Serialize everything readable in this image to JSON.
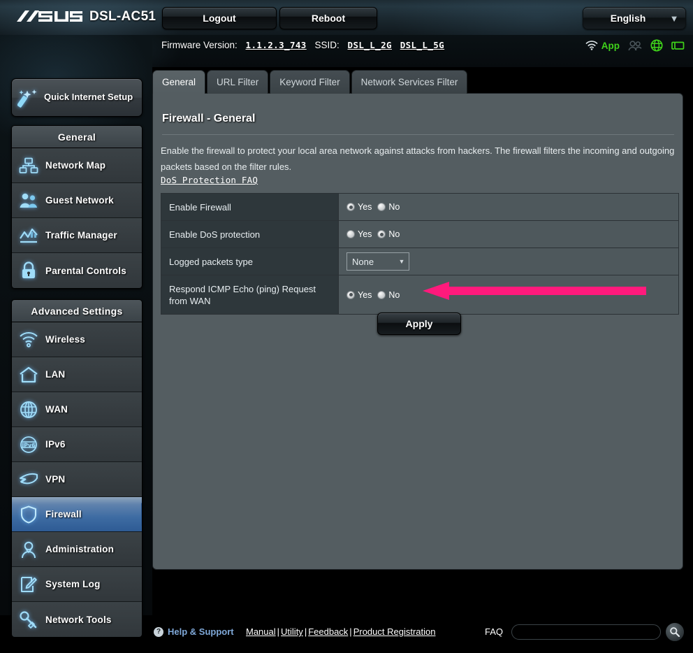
{
  "header": {
    "brand": "ASUS",
    "model": "DSL-AC51",
    "logout_label": "Logout",
    "reboot_label": "Reboot",
    "language": "English",
    "firmware_label": "Firmware Version:",
    "firmware_version": "1.1.2.3_743",
    "ssid_label": "SSID:",
    "ssid_2g": "DSL_L_2G",
    "ssid_5g": "DSL_L_5G",
    "app_label": "App",
    "icons": [
      "wifi-icon",
      "app-icon",
      "guests-icon",
      "globe-icon",
      "monitor-icon"
    ]
  },
  "sidebar": {
    "quick_setup": "Quick Internet Setup",
    "groups": [
      {
        "title": "General",
        "items": [
          {
            "label": "Network Map",
            "icon": "network-map-icon",
            "active": false
          },
          {
            "label": "Guest Network",
            "icon": "guest-network-icon",
            "active": false
          },
          {
            "label": "Traffic Manager",
            "icon": "traffic-manager-icon",
            "active": false
          },
          {
            "label": "Parental Controls",
            "icon": "parental-controls-icon",
            "active": false
          }
        ]
      },
      {
        "title": "Advanced Settings",
        "items": [
          {
            "label": "Wireless",
            "icon": "wireless-icon",
            "active": false
          },
          {
            "label": "LAN",
            "icon": "lan-icon",
            "active": false
          },
          {
            "label": "WAN",
            "icon": "wan-icon",
            "active": false
          },
          {
            "label": "IPv6",
            "icon": "ipv6-icon",
            "active": false
          },
          {
            "label": "VPN",
            "icon": "vpn-icon",
            "active": false
          },
          {
            "label": "Firewall",
            "icon": "firewall-icon",
            "active": true
          },
          {
            "label": "Administration",
            "icon": "administration-icon",
            "active": false
          },
          {
            "label": "System Log",
            "icon": "system-log-icon",
            "active": false
          },
          {
            "label": "Network Tools",
            "icon": "network-tools-icon",
            "active": false
          }
        ]
      }
    ]
  },
  "tabs": [
    {
      "label": "General",
      "active": true
    },
    {
      "label": "URL Filter",
      "active": false
    },
    {
      "label": "Keyword Filter",
      "active": false
    },
    {
      "label": "Network Services Filter",
      "active": false
    }
  ],
  "panel": {
    "title": "Firewall - General",
    "description": "Enable the firewall to protect your local area network against attacks from hackers. The firewall filters the incoming and outgoing packets based on the filter rules.",
    "faq_link": "DoS Protection FAQ",
    "apply_label": "Apply",
    "rows": [
      {
        "label": "Enable Firewall",
        "type": "radio",
        "yes_label": "Yes",
        "no_label": "No",
        "value": "Yes"
      },
      {
        "label": "Enable DoS protection",
        "type": "radio",
        "yes_label": "Yes",
        "no_label": "No",
        "value": "No"
      },
      {
        "label": "Logged packets type",
        "type": "select",
        "value": "None"
      },
      {
        "label": "Respond ICMP Echo (ping) Request from WAN",
        "type": "radio",
        "yes_label": "Yes",
        "no_label": "No",
        "value": "Yes"
      }
    ]
  },
  "annotation": {
    "type": "arrow",
    "color": "#ff1a7c",
    "points_to": "respond-icmp-row"
  },
  "footer": {
    "help_support": "Help & Support",
    "links": [
      "Manual",
      "Utility",
      "Feedback",
      "Product Registration"
    ],
    "separator": "|",
    "faq_label": "FAQ",
    "faq_placeholder": "",
    "faq_value": ""
  },
  "colors": {
    "accent_blue": "#2e5b94",
    "panel_bg": "#545d61",
    "row_label_bg": "#2e373b",
    "row_value_bg": "#4e585c",
    "green": "#3fd21a",
    "annotation_pink": "#ff1a7c"
  }
}
